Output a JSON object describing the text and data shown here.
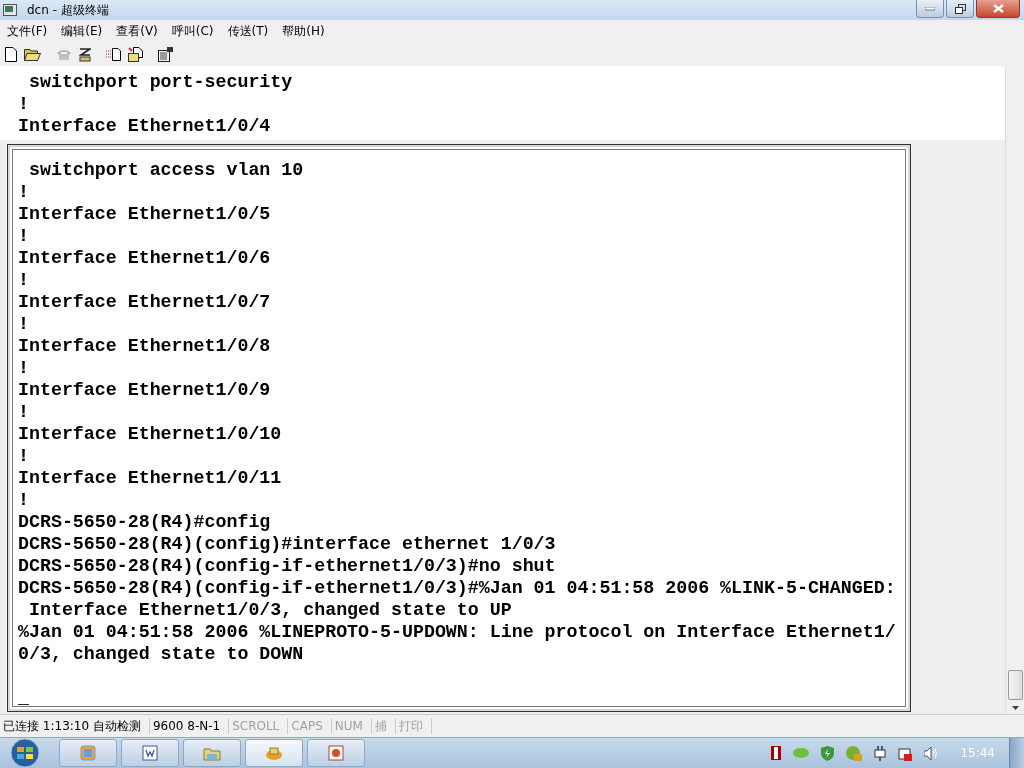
{
  "window": {
    "title": "dcn - 超级终端"
  },
  "menu": [
    "文件(F)",
    "编辑(E)",
    "查看(V)",
    "呼叫(C)",
    "传送(T)",
    "帮助(H)"
  ],
  "terminal": {
    "lines": [
      " switchport port-security",
      "!",
      "Interface Ethernet1/0/4"
    ],
    "panel_lines": [
      " switchport access vlan 10",
      "!",
      "Interface Ethernet1/0/5",
      "!",
      "Interface Ethernet1/0/6",
      "!",
      "Interface Ethernet1/0/7",
      "!",
      "Interface Ethernet1/0/8",
      "!",
      "Interface Ethernet1/0/9",
      "!",
      "Interface Ethernet1/0/10",
      "!",
      "Interface Ethernet1/0/11",
      "!",
      "DCRS-5650-28(R4)#config",
      "DCRS-5650-28(R4)(config)#interface ethernet 1/0/3",
      "DCRS-5650-28(R4)(config-if-ethernet1/0/3)#no shut",
      "DCRS-5650-28(R4)(config-if-ethernet1/0/3)#%Jan 01 04:51:58 2006 %LINK-5-CHANGED:",
      " Interface Ethernet1/0/3, changed state to UP",
      "%Jan 01 04:51:58 2006 %LINEPROTO-5-UPDOWN: Line protocol on Interface Ethernet1/",
      "0/3, changed state to DOWN"
    ],
    "cursor": "_"
  },
  "status_bar": [
    {
      "text": "已连接 1:13:10 自动检测",
      "disabled": false
    },
    {
      "text": "9600 8-N-1",
      "disabled": false
    },
    {
      "text": "SCROLL",
      "disabled": true
    },
    {
      "text": "CAPS",
      "disabled": true
    },
    {
      "text": "NUM",
      "disabled": true
    },
    {
      "text": "捕",
      "disabled": true
    },
    {
      "text": "打印",
      "disabled": true
    }
  ],
  "taskbar": {
    "clock": "15:44"
  }
}
